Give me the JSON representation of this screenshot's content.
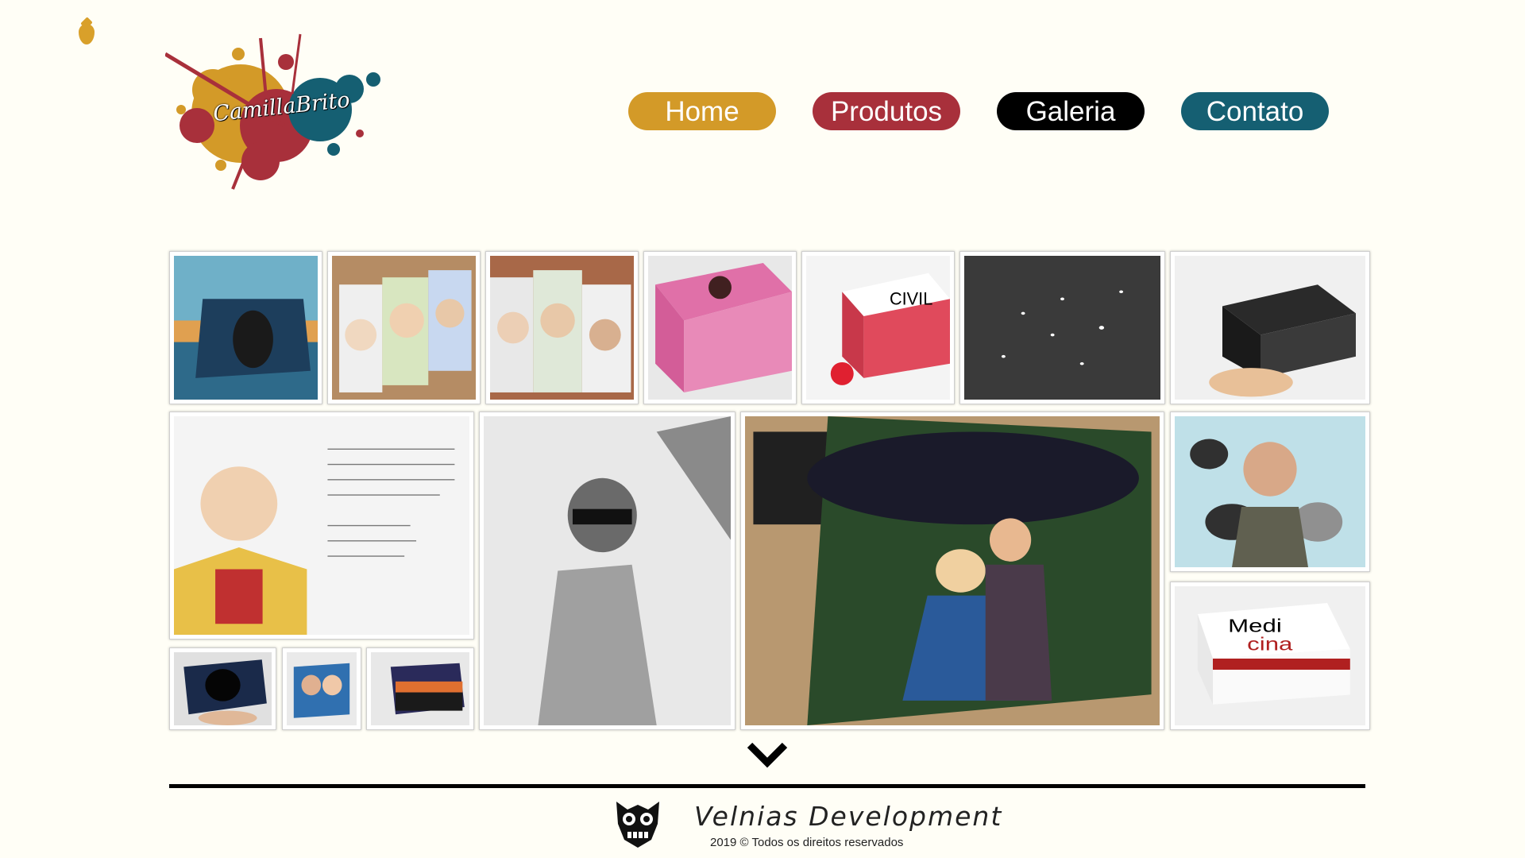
{
  "logo": {
    "signature": "CamillaBrito",
    "colors": {
      "gold": "#d39a28",
      "red": "#a8303b",
      "teal": "#155f72"
    }
  },
  "nav": {
    "items": [
      {
        "label": "Home",
        "color": "#d39a28"
      },
      {
        "label": "Produtos",
        "color": "#a8303b"
      },
      {
        "label": "Galeria",
        "color": "#000000"
      },
      {
        "label": "Contato",
        "color": "#155f72"
      }
    ]
  },
  "gallery": {
    "rows": 2,
    "tiles": [
      "beach-sunset-box",
      "couple-caricature-cards",
      "family-caricature-cards",
      "pink-couple-box",
      "civil-brick-box",
      "night-sky-signature",
      "direito-box",
      "priest-portrait-letter",
      "pencil-woman-portrait",
      "couple-garden-painting",
      "pets-portrait",
      "darth-vader-box",
      "couple-photo-box",
      "sunset-city-box",
      "medicina-box"
    ]
  },
  "scroll": {
    "icon": "chevron-down-icon"
  },
  "footer": {
    "brand": "Velnias Development",
    "copyright": "2019 © Todos os direitos reservados",
    "icon": "owl-mask-icon"
  }
}
